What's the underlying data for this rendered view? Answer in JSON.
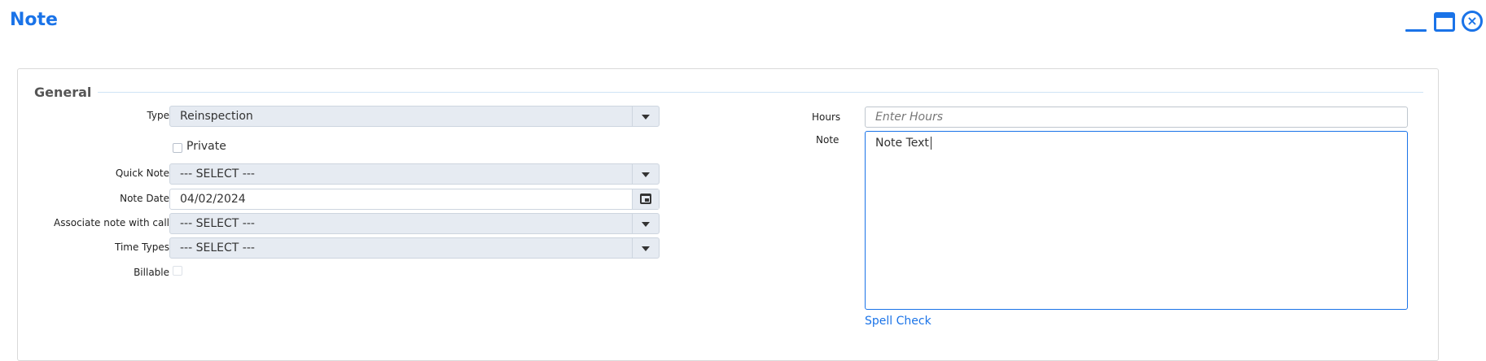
{
  "window": {
    "title": "Note",
    "controls": [
      "minimize-icon",
      "maximize-icon",
      "close-icon"
    ],
    "close_glyph": "×"
  },
  "colors": {
    "accent": "#1a73e8",
    "select_background": "#e6ebf2",
    "fieldset_line": "#cfe3f5"
  },
  "general": {
    "legend": "General",
    "type": {
      "label": "Type",
      "value": "Reinspection"
    },
    "private": {
      "label": "Private",
      "checked": false
    },
    "quick_note": {
      "label": "Quick Note",
      "value": "--- SELECT ---"
    },
    "note_date": {
      "label": "Note Date",
      "value": "04/02/2024"
    },
    "associate_call": {
      "label": "Associate note with call",
      "value": "--- SELECT ---"
    },
    "time_types": {
      "label": "Time Types",
      "value": "--- SELECT ---"
    },
    "billable": {
      "label": "Billable",
      "checked": false
    },
    "hours": {
      "label": "Hours",
      "placeholder": "Enter Hours"
    },
    "note": {
      "label": "Note",
      "value": "Note Text"
    },
    "spell_check": "Spell Check"
  }
}
